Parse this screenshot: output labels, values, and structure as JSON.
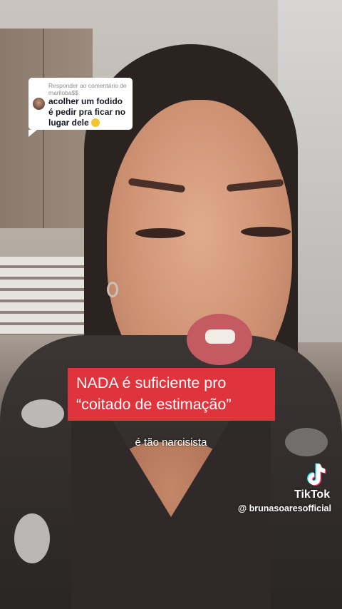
{
  "reply": {
    "header": "Responder ao comentário de mariloba$$",
    "text": "acolher um fodido é pedir pra ficar no lugar dele",
    "emoji_icon": "smiling-face-emoji"
  },
  "caption": {
    "line1": "NADA é suficiente pro",
    "line2": "“coitado de estimação”",
    "background_color": "#e0343d"
  },
  "subtitle": "é tão narcisista",
  "watermark": {
    "brand": "TikTok",
    "handle": "@ brunasoaresofficial",
    "logo_icon": "tiktok-note-icon"
  }
}
